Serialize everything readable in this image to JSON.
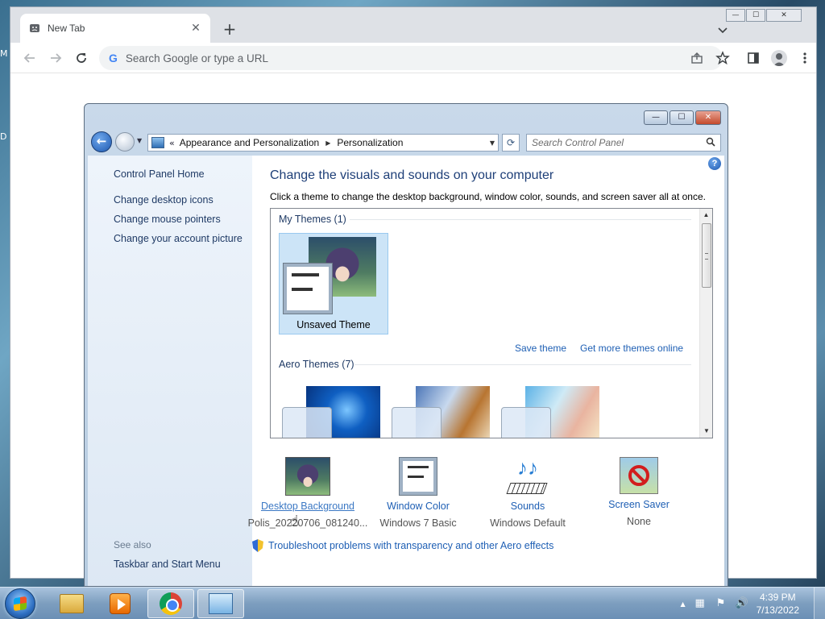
{
  "desktop": {
    "left_labels": [
      "M",
      "D"
    ]
  },
  "chrome": {
    "tab_title": "New Tab",
    "new_tab_symbol": "+",
    "close_symbol": "✕",
    "omnibox_placeholder": "Search Google or type a URL",
    "g_letter": "G"
  },
  "cp": {
    "caption_buttons": {
      "minimize": "—",
      "maximize": "☐",
      "close": "✕"
    },
    "address": {
      "overflow": "«",
      "crumbs": [
        "Appearance and Personalization",
        "Personalization"
      ],
      "arrow": "▶"
    },
    "search_placeholder": "Search Control Panel",
    "left_nav": {
      "home": "Control Panel Home",
      "links": [
        "Change desktop icons",
        "Change mouse pointers",
        "Change your account picture"
      ],
      "see_also": "See also",
      "see_also_link": "Taskbar and Start Menu"
    },
    "main": {
      "heading": "Change the visuals and sounds on your computer",
      "subtitle": "Click a theme to change the desktop background, window color, sounds, and screen saver all at once.",
      "my_themes_header": "My Themes (1)",
      "unsaved_theme_label": "Unsaved Theme",
      "save_theme": "Save theme",
      "more_themes": "Get more themes online",
      "aero_header": "Aero Themes (7)",
      "help_symbol": "?"
    },
    "bottom": [
      {
        "link": "Desktop Background",
        "value": "Polis_20220706_081240..."
      },
      {
        "link": "Window Color",
        "value": "Windows 7 Basic"
      },
      {
        "link": "Sounds",
        "value": "Windows Default"
      },
      {
        "link": "Screen Saver",
        "value": "None"
      }
    ],
    "troubleshoot": "Troubleshoot problems with transparency and other Aero effects"
  },
  "taskbar": {
    "time": "4:39 PM",
    "date": "7/13/2022"
  },
  "colors": {
    "link_blue": "#1e5fb4",
    "heading_blue": "#1e3f78",
    "selected_tile": "#cce4f7"
  }
}
